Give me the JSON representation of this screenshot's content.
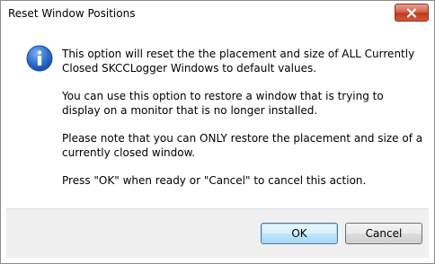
{
  "window": {
    "title": "Reset Window Positions",
    "close_icon": "close-icon"
  },
  "message": {
    "icon": "info-icon",
    "paragraphs": [
      "This option will reset the the placement and size of ALL Currently Closed SKCCLogger Windows to default values.",
      "You can use this option to restore a window that is trying to display on a monitor that is no longer installed.",
      "Please note that you can ONLY restore the placement and size of a currently closed window.",
      "Press \"OK\" when ready or \"Cancel\" to cancel this action."
    ]
  },
  "buttons": {
    "ok_label": "OK",
    "cancel_label": "Cancel"
  },
  "colors": {
    "close_button": "#c7502f",
    "info_icon": "#2f6fd3",
    "footer_bg": "#f0f0f0",
    "default_button_border": "#3c7fb1"
  }
}
